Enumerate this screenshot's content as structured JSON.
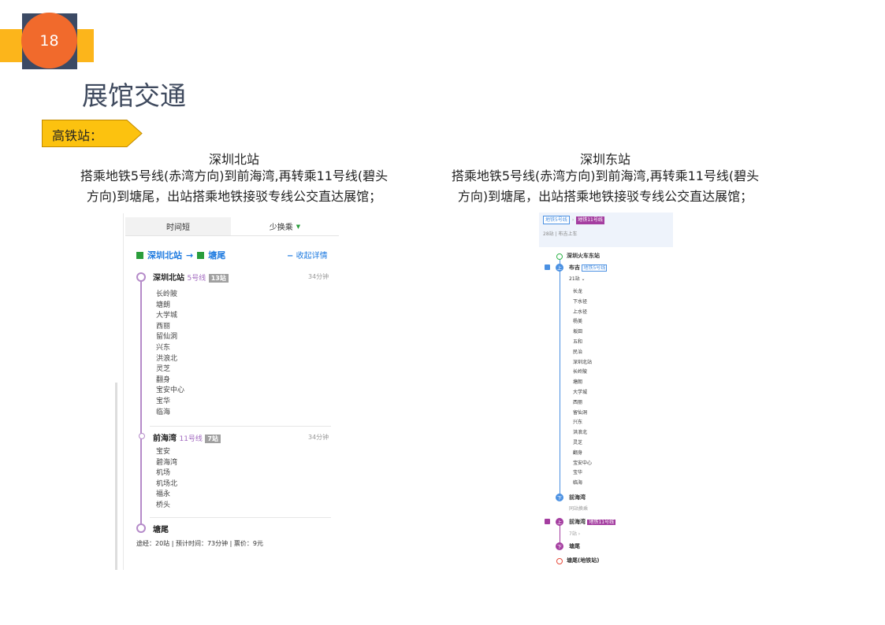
{
  "page_number": "18",
  "title": "展馆交通",
  "tag": "高铁站：",
  "left": {
    "station": "深圳北站",
    "desc_line1": "搭乘地铁5号线(赤湾方向)到前海湾,再转乘11号线(碧头",
    "desc_line2": "方向)到塘尾，出站搭乘地铁接驳专线公交直达展馆；",
    "shot": {
      "tab1": "时间短",
      "tab2": "少换乘",
      "route_from": "深圳北站",
      "arrow": "→",
      "route_to": "塘尾",
      "collapse": "收起详情",
      "seg1": {
        "station": "深圳北站",
        "line": "5号线",
        "count": "13站",
        "time": "34分钟",
        "stops": [
          "长岭陂",
          "塘朗",
          "大学城",
          "西丽",
          "留仙洞",
          "兴东",
          "洪浪北",
          "灵芝",
          "翻身",
          "宝安中心",
          "宝华",
          "临海"
        ]
      },
      "seg2": {
        "station": "前海湾",
        "line": "11号线",
        "count": "7站",
        "time": "34分钟",
        "stops": [
          "宝安",
          "碧海湾",
          "机场",
          "机场北",
          "福永",
          "桥头"
        ]
      },
      "end": "塘尾",
      "summary": "途经：20站 | 预计时间：73分钟 | 票价：9元"
    }
  },
  "right": {
    "station": "深圳东站",
    "desc_line1": "搭乘地铁5号线(赤湾方向)到前海湾,再转乘11号线(碧头",
    "desc_line2": "方向)到塘尾，出站搭乘地铁接驳专线公交直达展馆；",
    "shot": {
      "tag1": "地铁5号线",
      "tag2": "地铁11号线",
      "meta": "28站 | 布吉上车",
      "start": "深圳火车东站",
      "board1": "布吉",
      "board1_line": "地铁5号线",
      "count1": "21站 ⌄",
      "stops": [
        "长龙",
        "下水径",
        "上水径",
        "杨美",
        "坂田",
        "五和",
        "民治",
        "深圳北站",
        "长岭陂",
        "塘朗",
        "大学城",
        "西丽",
        "留仙洞",
        "兴东",
        "洪浪北",
        "灵芝",
        "翻身",
        "宝安中心",
        "宝华",
        "临海"
      ],
      "alight1": "前海湾",
      "transfer_note": "同站换乘",
      "board2": "前海湾",
      "board2_line": "地铁11号线",
      "count2": "7站 ›",
      "alight2": "塘尾",
      "end": "塘尾(地铁站)"
    }
  },
  "colors": {
    "orange": "#f16a2c",
    "yellow": "#fcb51b",
    "navy": "#3c4a64",
    "line5": "#9b59b6",
    "line11": "#8e44ad",
    "blue": "#4a90e2"
  }
}
